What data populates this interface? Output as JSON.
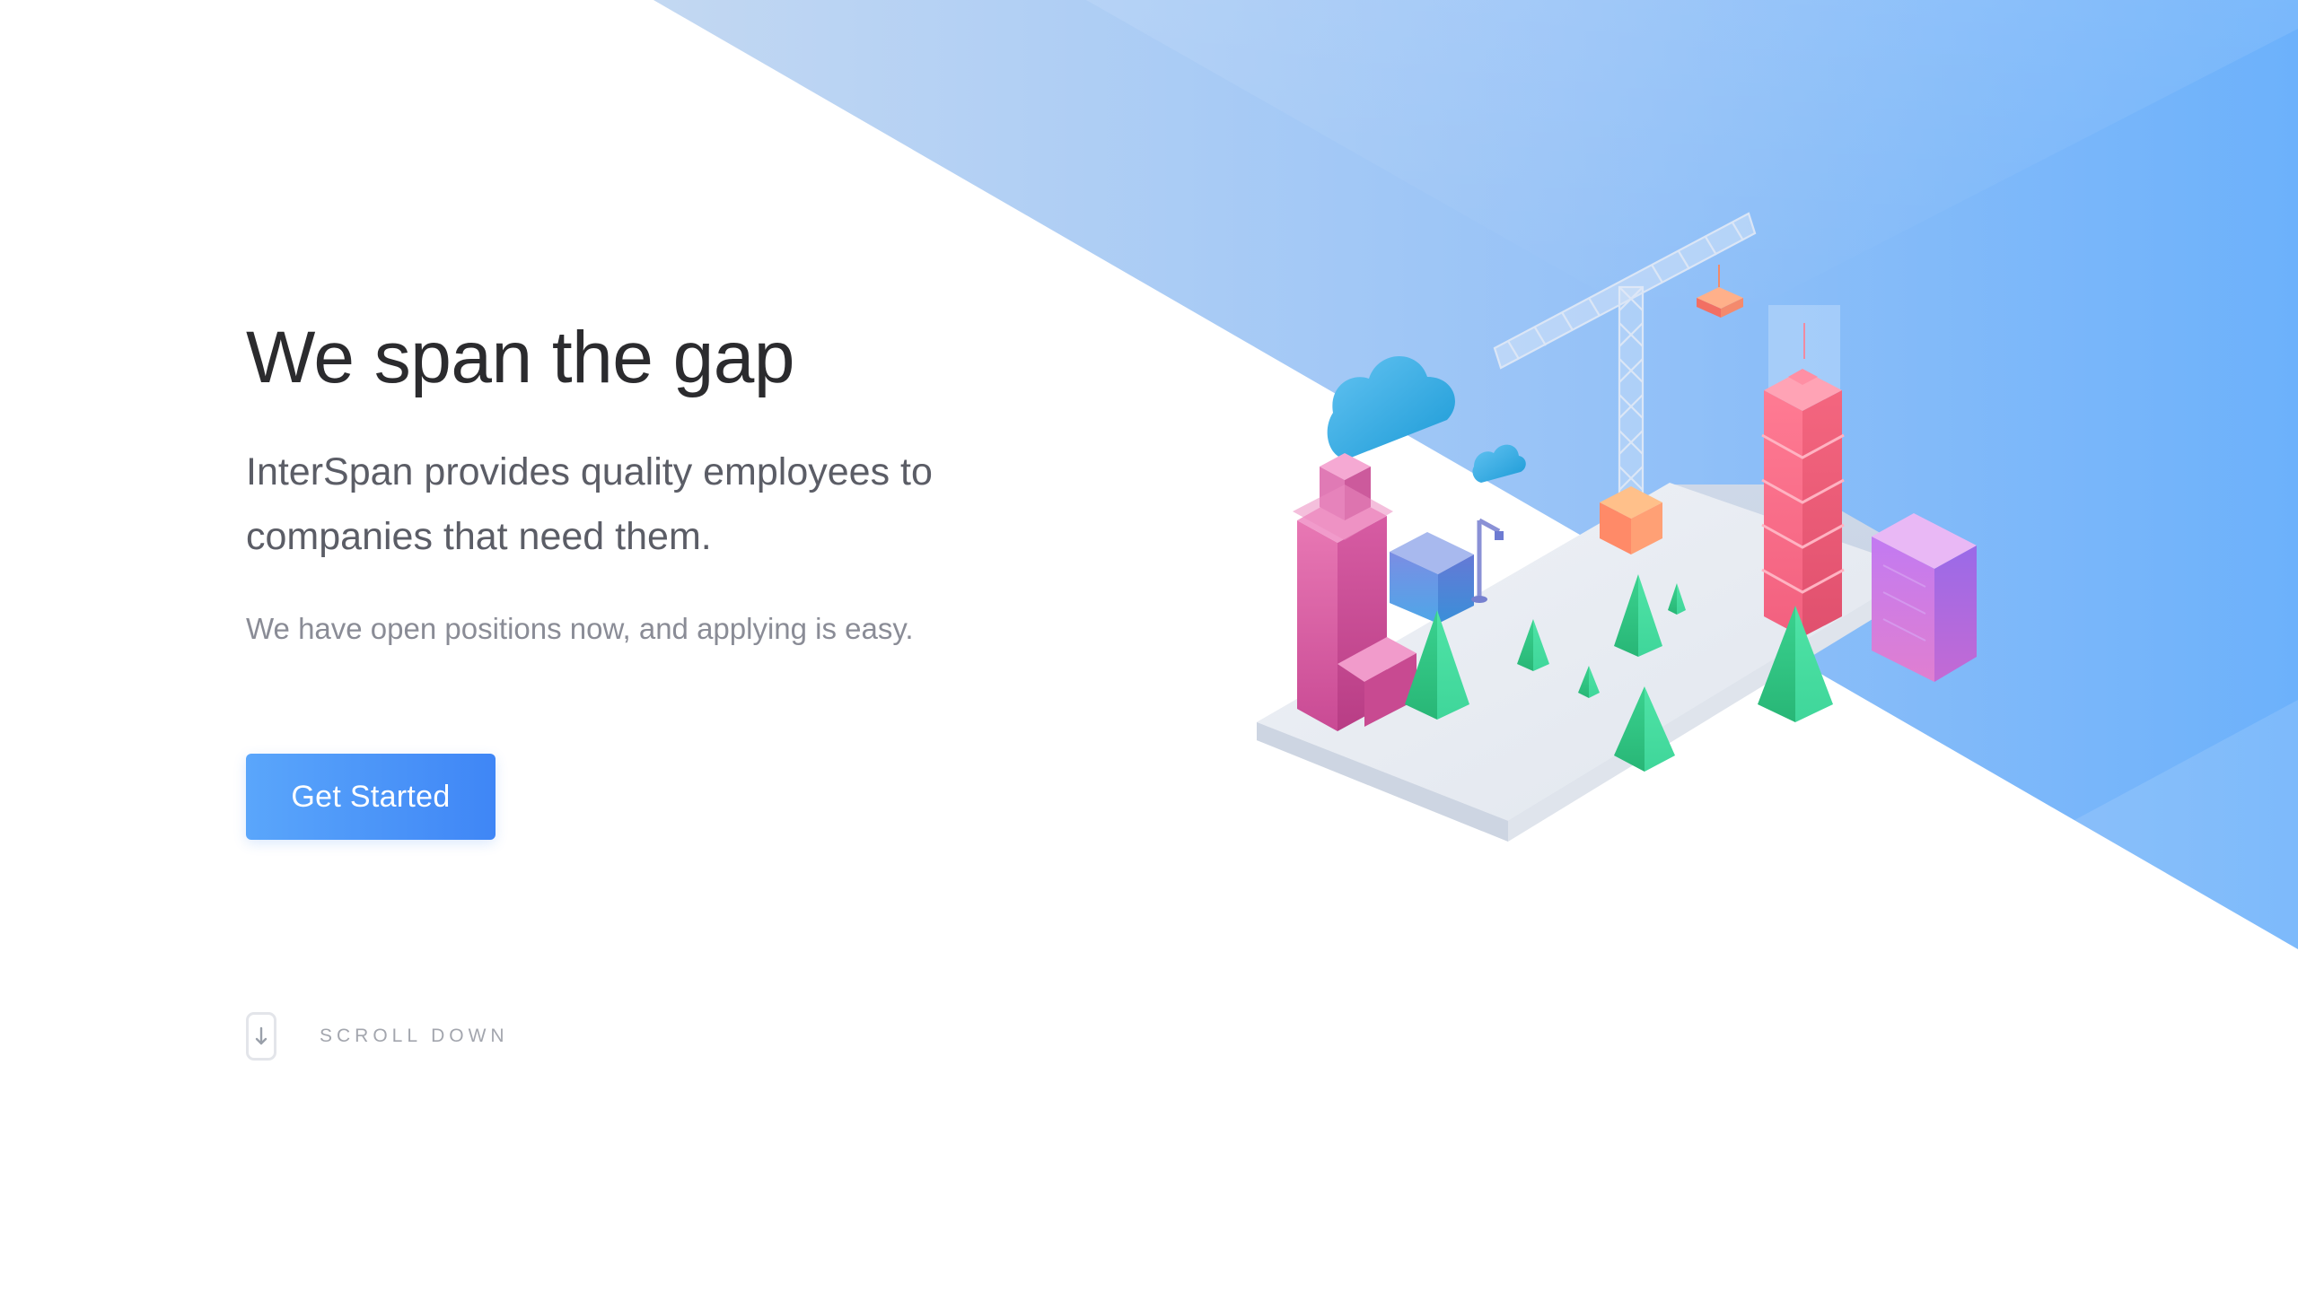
{
  "hero": {
    "title": "We span the gap",
    "lead": "InterSpan provides quality employees to companies that need them.",
    "subtext": "We have open positions now, and applying is easy."
  },
  "cta": {
    "label": "Get Started"
  },
  "scroll": {
    "label": "SCROLL DOWN",
    "icon": "arrow-down-icon"
  },
  "theme": {
    "accent": "#3f86f6",
    "accent_light": "#5aa6fb",
    "background_gradient_start": "#c3d8f2",
    "background_gradient_end": "#6cb1fb",
    "title_color": "#2b2b2e",
    "body_color": "#5b5d66",
    "muted_color": "#8a8c96"
  },
  "illustration": {
    "name": "isometric-city-construction",
    "elements": [
      "platform",
      "crane",
      "pink-tower",
      "red-skyscraper",
      "purple-building",
      "blue-block",
      "clouds",
      "trees",
      "orange-crate",
      "streetlamp"
    ]
  }
}
